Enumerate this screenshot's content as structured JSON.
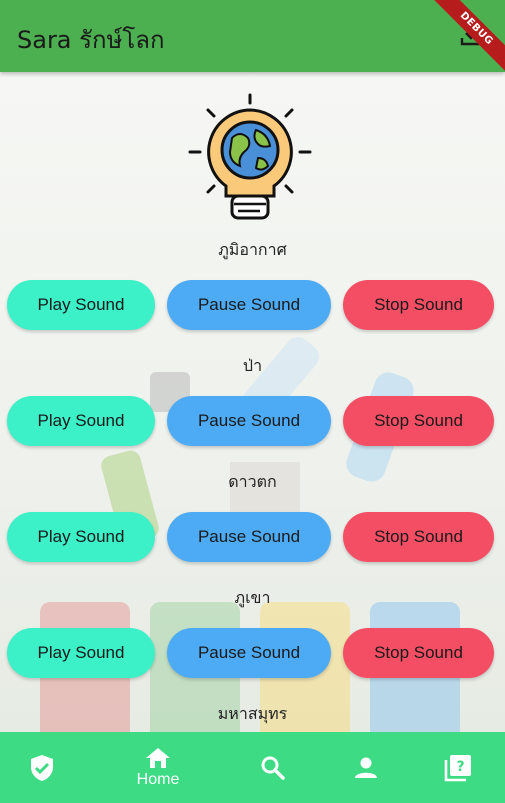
{
  "appbar": {
    "title": "Sara รักษ์โลก",
    "debug_label": "DEBUG"
  },
  "sections": [
    {
      "label": "ภูมิอากาศ",
      "play": "Play Sound",
      "pause": "Pause Sound",
      "stop": "Stop Sound"
    },
    {
      "label": "ป่า",
      "play": "Play Sound",
      "pause": "Pause Sound",
      "stop": "Stop Sound"
    },
    {
      "label": "ดาวตก",
      "play": "Play Sound",
      "pause": "Pause Sound",
      "stop": "Stop Sound"
    },
    {
      "label": "ภูเขา",
      "play": "Play Sound",
      "pause": "Pause Sound",
      "stop": "Stop Sound"
    },
    {
      "label": "มหาสมุทร"
    }
  ],
  "bottom_nav": {
    "items": [
      {
        "icon": "shield-check-icon",
        "label": ""
      },
      {
        "icon": "home-icon",
        "label": "Home"
      },
      {
        "icon": "search-icon",
        "label": ""
      },
      {
        "icon": "person-icon",
        "label": ""
      },
      {
        "icon": "quiz-icon",
        "label": ""
      }
    ],
    "selected_index": 1
  },
  "colors": {
    "appbar": "#4caf50",
    "bottom_nav": "#3ddc84",
    "play": "#3cf0c8",
    "pause": "#4dabf5",
    "stop": "#f44e64"
  }
}
